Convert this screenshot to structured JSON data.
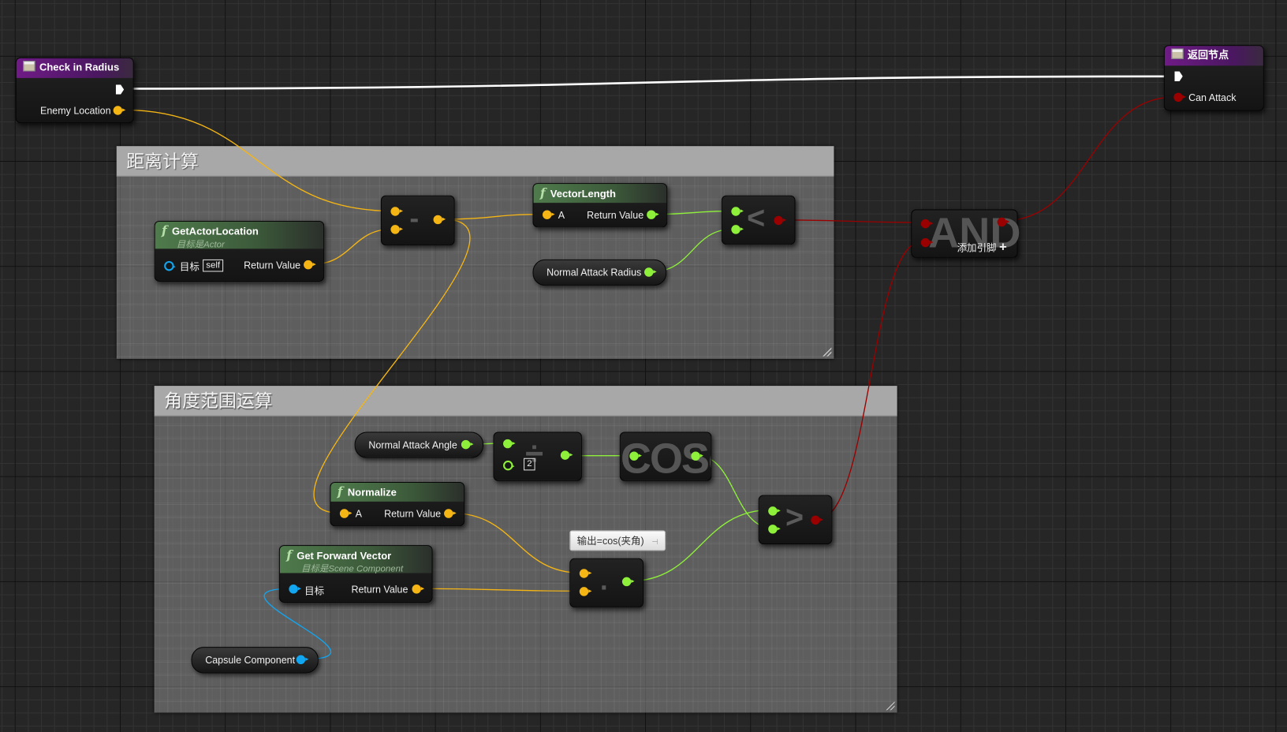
{
  "comments": [
    {
      "title": "距离计算"
    },
    {
      "title": "角度范围运算"
    }
  ],
  "event_node": {
    "title": "Check in Radius",
    "pins": {
      "enemy_location": "Enemy Location"
    }
  },
  "return_node": {
    "title": "返回节点",
    "pins": {
      "can_attack": "Can Attack"
    }
  },
  "get_actor_location": {
    "title": "GetActorLocation",
    "subtitle": "目标是Actor",
    "target_label": "目标",
    "target_value": "self",
    "return_label": "Return Value"
  },
  "subtract": {
    "symbol": "-"
  },
  "vector_length": {
    "title": "VectorLength",
    "input_label": "A",
    "return_label": "Return Value"
  },
  "less": {
    "symbol": "<"
  },
  "normal_attack_radius": {
    "label": "Normal Attack Radius"
  },
  "and_node": {
    "symbol": "AND",
    "add_pin_label": "添加引脚",
    "add_icon": "+"
  },
  "normal_attack_angle": {
    "label": "Normal Attack Angle"
  },
  "divide": {
    "symbol": "÷",
    "default_value": "2"
  },
  "cosd": {
    "symbol": "COSd"
  },
  "normalize": {
    "title": "Normalize",
    "input_label": "A",
    "return_label": "Return Value"
  },
  "get_forward_vector": {
    "title": "Get Forward Vector",
    "subtitle": "目标是Scene Component",
    "target_label": "目标",
    "return_label": "Return Value"
  },
  "dot": {
    "symbol": "·",
    "tooltip": "输出=cos(夹角)"
  },
  "greater": {
    "symbol": ">"
  },
  "capsule_component": {
    "label": "Capsule Component"
  },
  "colors": {
    "exec": "#ffffff",
    "vector": "#f4b515",
    "float": "#8ef03a",
    "bool": "#9a0000",
    "object": "#12a5f0",
    "function_header": "#4f7b4c",
    "event_header": "#6f1b86"
  }
}
